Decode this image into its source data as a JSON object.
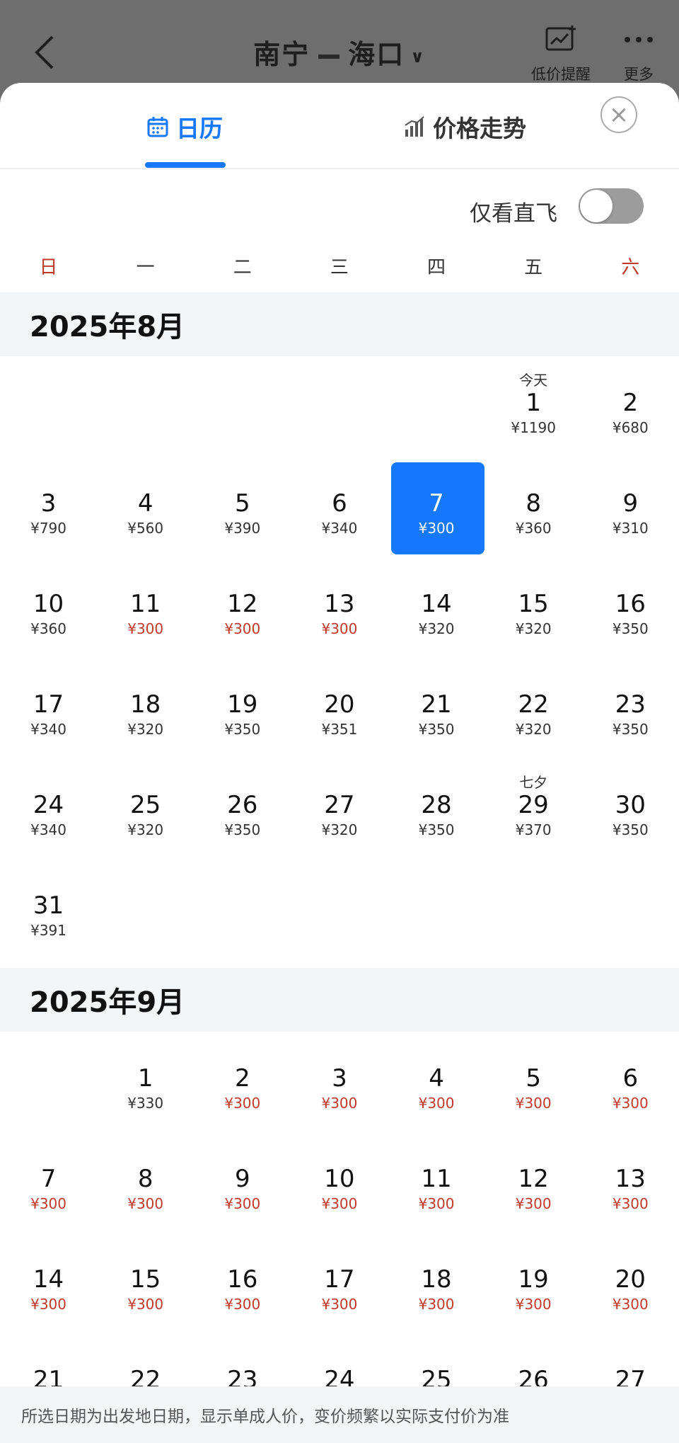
{
  "header": {
    "origin": "南宁",
    "destination": "海口",
    "low_price_alert_label": "低价提醒",
    "more_label": "更多"
  },
  "tabs": [
    {
      "label": "日历",
      "icon": "calendar-icon",
      "active": true
    },
    {
      "label": "价格走势",
      "icon": "bar-chart-icon",
      "active": false
    }
  ],
  "filters": {
    "direct_only_label": "仅看直飞",
    "direct_only_on": false
  },
  "weekdays": [
    "日",
    "一",
    "二",
    "三",
    "四",
    "五",
    "六"
  ],
  "months": [
    {
      "title": "2025年8月",
      "leading_blanks": 5,
      "days": [
        {
          "day": "1",
          "price": "¥1190",
          "tag": "今天"
        },
        {
          "day": "2",
          "price": "¥680"
        },
        {
          "day": "3",
          "price": "¥790"
        },
        {
          "day": "4",
          "price": "¥560"
        },
        {
          "day": "5",
          "price": "¥390"
        },
        {
          "day": "6",
          "price": "¥340"
        },
        {
          "day": "7",
          "price": "¥300",
          "selected": true
        },
        {
          "day": "8",
          "price": "¥360"
        },
        {
          "day": "9",
          "price": "¥310"
        },
        {
          "day": "10",
          "price": "¥360"
        },
        {
          "day": "11",
          "price": "¥300",
          "low": true
        },
        {
          "day": "12",
          "price": "¥300",
          "low": true
        },
        {
          "day": "13",
          "price": "¥300",
          "low": true
        },
        {
          "day": "14",
          "price": "¥320"
        },
        {
          "day": "15",
          "price": "¥320"
        },
        {
          "day": "16",
          "price": "¥350"
        },
        {
          "day": "17",
          "price": "¥340"
        },
        {
          "day": "18",
          "price": "¥320"
        },
        {
          "day": "19",
          "price": "¥350"
        },
        {
          "day": "20",
          "price": "¥351"
        },
        {
          "day": "21",
          "price": "¥350"
        },
        {
          "day": "22",
          "price": "¥320"
        },
        {
          "day": "23",
          "price": "¥350"
        },
        {
          "day": "24",
          "price": "¥340"
        },
        {
          "day": "25",
          "price": "¥320"
        },
        {
          "day": "26",
          "price": "¥350"
        },
        {
          "day": "27",
          "price": "¥320"
        },
        {
          "day": "28",
          "price": "¥350"
        },
        {
          "day": "29",
          "price": "¥370",
          "tag": "七夕"
        },
        {
          "day": "30",
          "price": "¥350"
        },
        {
          "day": "31",
          "price": "¥391"
        }
      ]
    },
    {
      "title": "2025年9月",
      "leading_blanks": 1,
      "days": [
        {
          "day": "1",
          "price": "¥330"
        },
        {
          "day": "2",
          "price": "¥300",
          "low": true
        },
        {
          "day": "3",
          "price": "¥300",
          "low": true
        },
        {
          "day": "4",
          "price": "¥300",
          "low": true
        },
        {
          "day": "5",
          "price": "¥300",
          "low": true
        },
        {
          "day": "6",
          "price": "¥300",
          "low": true
        },
        {
          "day": "7",
          "price": "¥300",
          "low": true
        },
        {
          "day": "8",
          "price": "¥300",
          "low": true
        },
        {
          "day": "9",
          "price": "¥300",
          "low": true
        },
        {
          "day": "10",
          "price": "¥300",
          "low": true
        },
        {
          "day": "11",
          "price": "¥300",
          "low": true
        },
        {
          "day": "12",
          "price": "¥300",
          "low": true
        },
        {
          "day": "13",
          "price": "¥300",
          "low": true
        },
        {
          "day": "14",
          "price": "¥300",
          "low": true
        },
        {
          "day": "15",
          "price": "¥300",
          "low": true
        },
        {
          "day": "16",
          "price": "¥300",
          "low": true
        },
        {
          "day": "17",
          "price": "¥300",
          "low": true
        },
        {
          "day": "18",
          "price": "¥300",
          "low": true
        },
        {
          "day": "19",
          "price": "¥300",
          "low": true
        },
        {
          "day": "20",
          "price": "¥300",
          "low": true
        },
        {
          "day": "21"
        },
        {
          "day": "22"
        },
        {
          "day": "23"
        },
        {
          "day": "24"
        },
        {
          "day": "25"
        },
        {
          "day": "26"
        },
        {
          "day": "27"
        }
      ]
    }
  ],
  "footer_note": "所选日期为出发地日期，显示单成人价，变价频繁以实际支付价为准",
  "colors": {
    "accent": "#1677ff",
    "low_price": "#c0392b"
  }
}
